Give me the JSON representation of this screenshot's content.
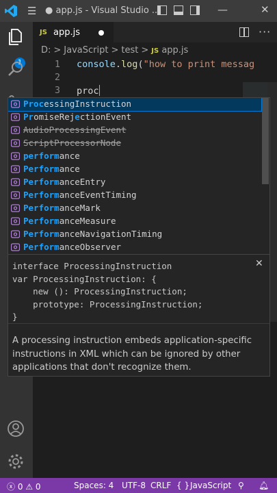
{
  "window": {
    "title": "● app.js - Visual Studio ...",
    "minimize_glyph": "—",
    "close_glyph": "✕"
  },
  "activity": {
    "badge": "1"
  },
  "tab": {
    "badge": "JS",
    "name": "app.js"
  },
  "breadcrumb": {
    "items": [
      "D:",
      "JavaScript",
      "test"
    ],
    "file_badge": "JS",
    "file": "app.js",
    "separator": ">"
  },
  "editor": {
    "lines": [
      {
        "number": "1",
        "obj": "console",
        "dot": ".",
        "fn": "log",
        "open": "(",
        "string": "\"how to print messag"
      },
      {
        "number": "2"
      },
      {
        "number": "3",
        "text": "proc"
      }
    ]
  },
  "suggest": {
    "items": [
      {
        "pre": "",
        "match": "Proc",
        "post": "essingInstruction"
      },
      {
        "pre": "",
        "match": "Pr",
        "post": "omiseRej",
        "match2": "e",
        "post2": "ctionEvent"
      },
      {
        "pre": "",
        "match": "",
        "post": "AudioProcessingEvent"
      },
      {
        "pre": "",
        "match": "",
        "post": "ScriptProcessorNode"
      },
      {
        "pre": "",
        "match": "perform",
        "post": "ance"
      },
      {
        "pre": "",
        "match": "Perform",
        "post": "ance"
      },
      {
        "pre": "",
        "match": "Perform",
        "post": "anceEntry"
      },
      {
        "pre": "",
        "match": "Perform",
        "post": "anceEventTiming"
      },
      {
        "pre": "",
        "match": "Perform",
        "post": "anceMark"
      },
      {
        "pre": "",
        "match": "Perform",
        "post": "anceMeasure"
      },
      {
        "pre": "",
        "match": "Perform",
        "post": "anceNavigationTiming"
      },
      {
        "pre": "",
        "match": "Perform",
        "post": "anceObserver"
      }
    ]
  },
  "details": {
    "signature": "interface ProcessingInstruction\nvar ProcessingInstruction: {\n    new (): ProcessingInstruction;\n    prototype: ProcessingInstruction;\n}",
    "documentation": "A processing instruction embeds application-specific instructions in XML which can be ignored by other applications that don't recognize them.",
    "close_glyph": "✕"
  },
  "statusbar": {
    "errors": "0",
    "warnings": "0",
    "spaces": "Spaces: 4",
    "encoding": "UTF-8",
    "eol": "CRLF",
    "language": "JavaScript",
    "language_icon": "{ }"
  },
  "colors": {
    "statusbar": "#7a39a7",
    "highlight": "#18a3ff",
    "selection": "#04395e"
  }
}
